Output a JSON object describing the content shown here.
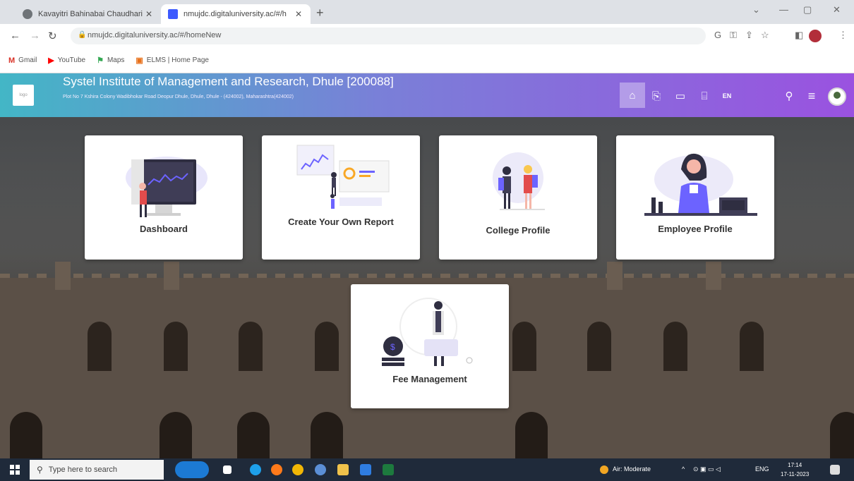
{
  "browser": {
    "tabs": [
      {
        "title": "Kavayitri Bahinabai Chaudhari N",
        "active": false
      },
      {
        "title": "nmujdc.digitaluniversity.ac/#/h",
        "active": true
      }
    ],
    "url": "nmujdc.digitaluniversity.ac/#/homeNew",
    "bookmarks": [
      {
        "label": "Gmail",
        "icon": "gmail-icon"
      },
      {
        "label": "YouTube",
        "icon": "youtube-icon"
      },
      {
        "label": "Maps",
        "icon": "maps-icon"
      },
      {
        "label": "ELMS | Home Page",
        "icon": "elms-icon"
      }
    ]
  },
  "header": {
    "logo_text": "logo",
    "institute_name": "Systel Institute of Management and Research, Dhule [200088]",
    "institute_address": "Plot No 7 Kshira Colony Wadibhokar Road Deopur Dhule, Dhule, Dhule - (424002), Maharashtra(424002)",
    "icons": [
      "home-icon",
      "course-icon",
      "screen-icon",
      "institution-icon",
      "language-icon",
      "search-icon",
      "menu-icon",
      "profile-avatar"
    ],
    "language_label": "EN"
  },
  "cards": [
    {
      "label": "Dashboard"
    },
    {
      "label": "Create Your Own Report"
    },
    {
      "label": "College Profile"
    },
    {
      "label": "Employee Profile"
    },
    {
      "label": "Fee Management"
    }
  ],
  "taskbar": {
    "search_placeholder": "Type here to search",
    "weather": "Air: Moderate",
    "language": "ENG",
    "time": "17:14",
    "date": "17-11-2023"
  },
  "colors": {
    "header_gradient_start": "#43b6c6",
    "header_gradient_end": "#9a52e0",
    "card_accent": "#6c63ff"
  }
}
